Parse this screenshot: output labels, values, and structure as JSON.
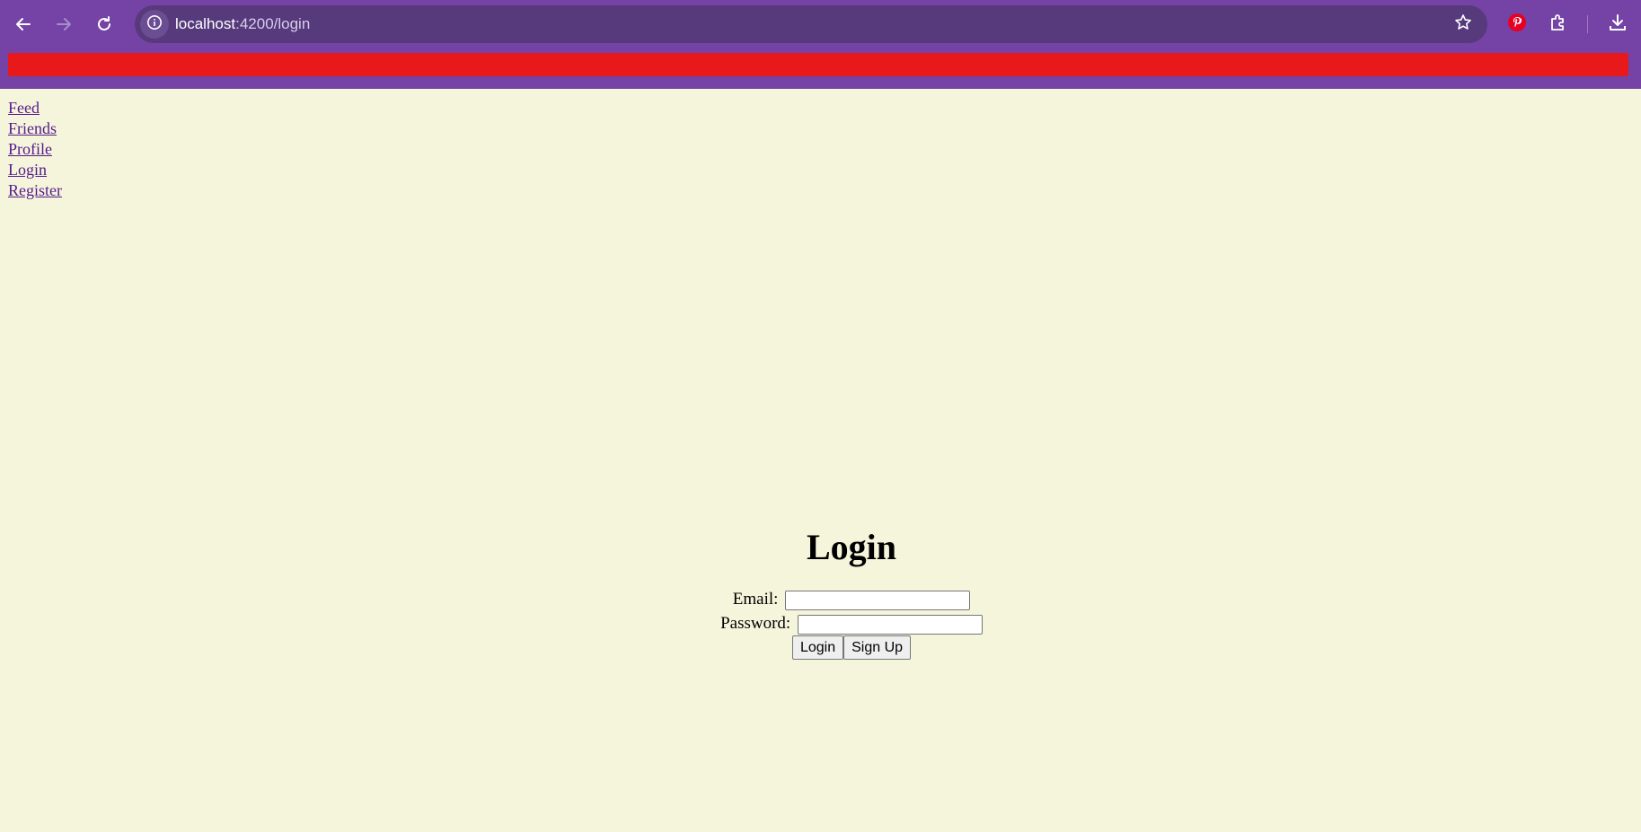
{
  "browser": {
    "url_host": "localhost",
    "url_path": ":4200/login",
    "chrome_color": "#7443a5",
    "omnibox_color": "#563a7c",
    "toolbar_icons": [
      "back-arrow-icon",
      "forward-arrow-icon",
      "reload-icon",
      "site-info-icon",
      "star-icon",
      "pinterest-icon",
      "extensions-puzzle-icon",
      "download-icon"
    ]
  },
  "banner": {
    "color": "#e8191b"
  },
  "nav": {
    "links": [
      {
        "label": "Feed"
      },
      {
        "label": "Friends"
      },
      {
        "label": "Profile"
      },
      {
        "label": "Login"
      },
      {
        "label": "Register"
      }
    ],
    "link_color": "#551a8b"
  },
  "login": {
    "title": "Login",
    "email_label": "Email:",
    "email_value": "",
    "password_label": "Password:",
    "password_value": "",
    "login_button": "Login",
    "signup_button": "Sign Up"
  },
  "page": {
    "background": "#f5f5dc"
  }
}
